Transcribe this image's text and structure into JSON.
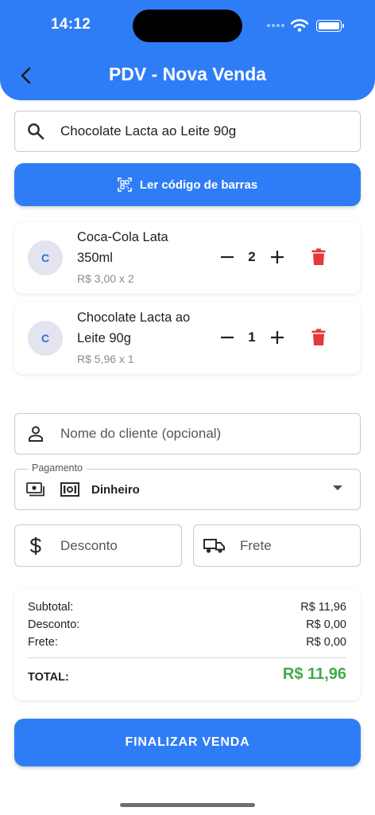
{
  "status_bar": {
    "time": "14:12"
  },
  "header": {
    "title": "PDV - Nova Venda",
    "back_icon": "chevron-left-icon"
  },
  "search": {
    "value": "Chocolate Lacta ao Leite 90g",
    "icon": "search-icon"
  },
  "scan_button": {
    "label": "Ler código de barras",
    "icon": "barcode-scan-icon"
  },
  "cart_items": [
    {
      "initial": "C",
      "name": "Coca-Cola Lata 350ml",
      "price_line": "R$ 3,00 x 2",
      "quantity": "2"
    },
    {
      "initial": "C",
      "name": "Chocolate Lacta ao Leite 90g",
      "price_line": "R$ 5,96 x 1",
      "quantity": "1"
    }
  ],
  "client_field": {
    "placeholder": "Nome do cliente (opcional)",
    "icon": "person-icon"
  },
  "payment": {
    "label": "Pagamento",
    "selected": "Dinheiro",
    "icon": "cash-icon",
    "option_icon": "money-bill-icon"
  },
  "discount_field": {
    "placeholder": "Desconto",
    "icon": "dollar-icon"
  },
  "shipping_field": {
    "placeholder": "Frete",
    "icon": "truck-icon"
  },
  "summary": {
    "subtotal_label": "Subtotal:",
    "subtotal_value": "R$ 11,96",
    "discount_label": "Desconto:",
    "discount_value": "R$ 0,00",
    "shipping_label": "Frete:",
    "shipping_value": "R$ 0,00",
    "total_label": "TOTAL:",
    "total_value": "R$ 11,96"
  },
  "finish_button": {
    "label": "FINALIZAR VENDA"
  },
  "colors": {
    "primary": "#2f7df6",
    "danger": "#e53935",
    "total": "#43a84a"
  }
}
